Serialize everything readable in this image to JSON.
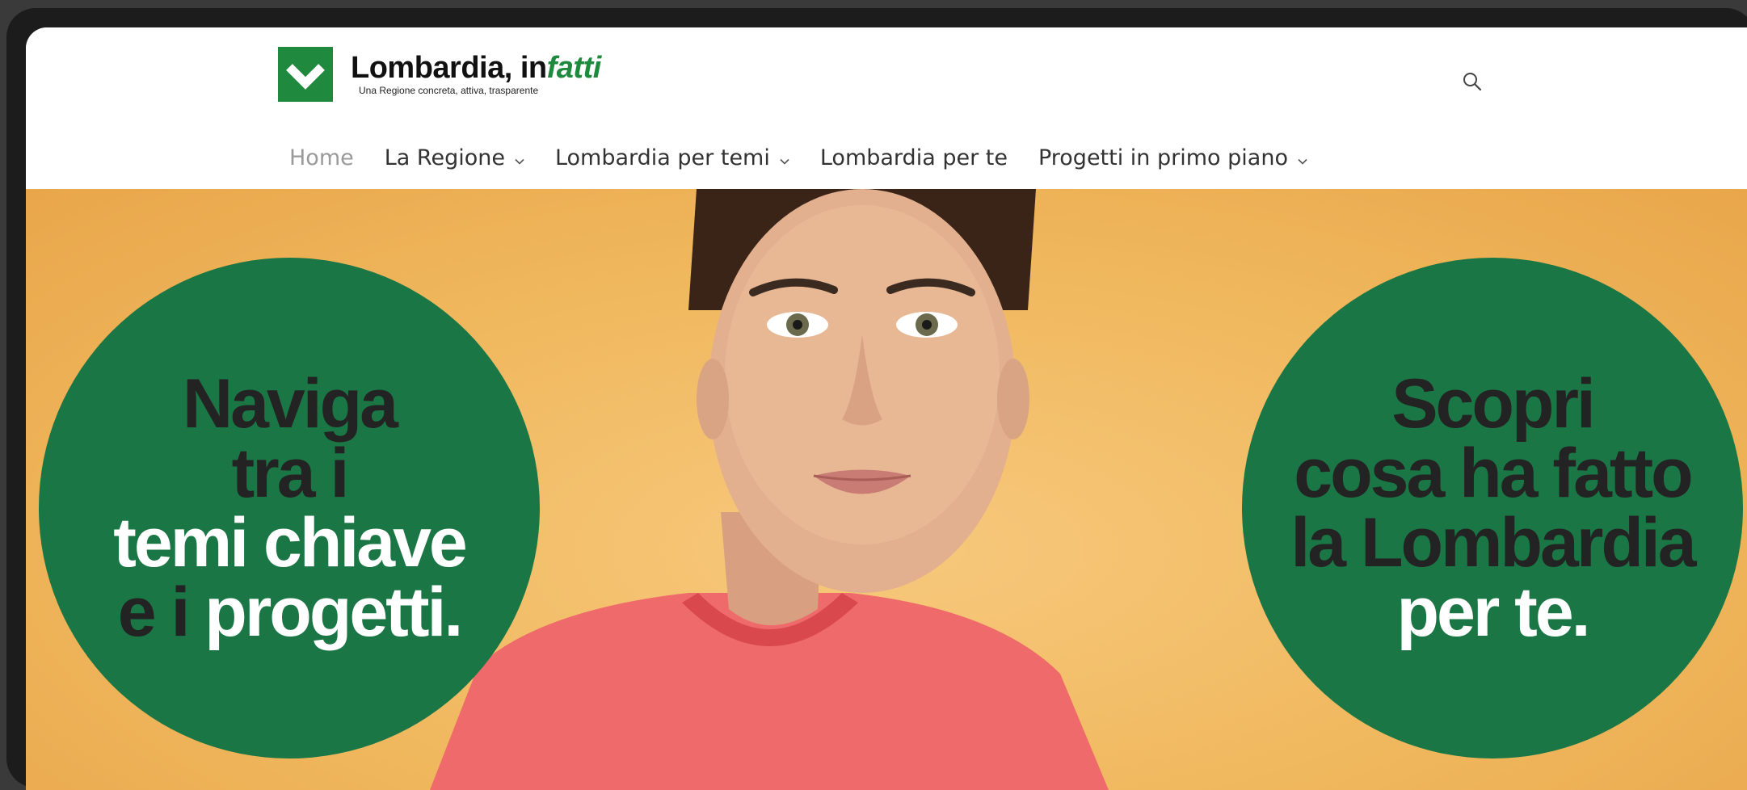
{
  "header": {
    "logo": {
      "name_main": "Lombardia, in",
      "name_accent": "fatti",
      "tagline": "Una Regione concreta, attiva, trasparente",
      "brand_color": "#1f8a3e"
    },
    "search_icon": "search-icon"
  },
  "nav": {
    "items": [
      {
        "label": "Home",
        "has_dropdown": false,
        "active": true
      },
      {
        "label": "La Regione",
        "has_dropdown": true
      },
      {
        "label": "Lombardia per temi",
        "has_dropdown": true
      },
      {
        "label": "Lombardia per te",
        "has_dropdown": false
      },
      {
        "label": "Progetti in primo piano",
        "has_dropdown": true
      }
    ]
  },
  "hero": {
    "left_circle": {
      "line1": "Naviga",
      "line2": "tra i",
      "line3": "temi chiave",
      "line4_a": "e i",
      "line4_b": "progetti."
    },
    "right_circle": {
      "line1": "Scopri",
      "line2": "cosa ha fatto",
      "line3": "la Lombardia",
      "line4": "per te."
    },
    "colors": {
      "circle": "#1a7645",
      "background": "#f0b85e",
      "shirt": "#ef6a6b"
    }
  }
}
